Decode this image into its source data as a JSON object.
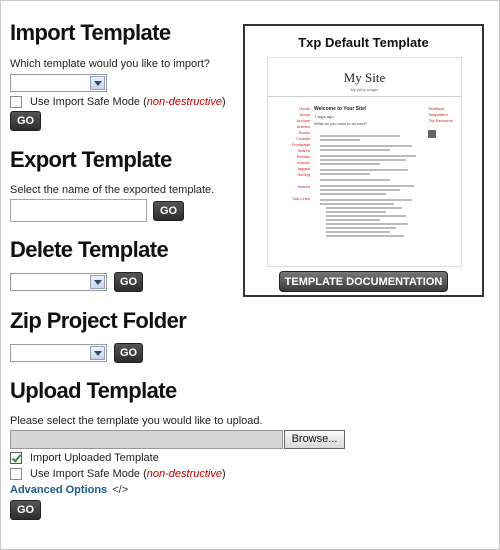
{
  "import": {
    "heading": "Import Template",
    "prompt": "Which template would you like to import?",
    "safe_mode_label": "Use Import Safe Mode (",
    "safe_mode_note": "non-destructive",
    "safe_mode_close": ")",
    "safe_mode_checked": false,
    "go_label": "GO"
  },
  "export": {
    "heading": "Export Template",
    "prompt": "Select the name of the exported template.",
    "name_value": "",
    "go_label": "GO"
  },
  "delete": {
    "heading": "Delete Template",
    "go_label": "GO"
  },
  "zip": {
    "heading": "Zip Project Folder",
    "go_label": "GO"
  },
  "upload": {
    "heading": "Upload Template",
    "prompt": "Please select the template you would like to upload.",
    "browse_label": "Browse...",
    "import_uploaded_label": "Import Uploaded Template",
    "import_uploaded_checked": true,
    "safe_mode_label": "Use Import Safe Mode (",
    "safe_mode_note": "non-destructive",
    "safe_mode_close": ")",
    "safe_mode_checked": false,
    "advanced_label": "Advanced Options",
    "advanced_suffix": "</>",
    "go_label": "GO"
  },
  "preview": {
    "title": "Txp Default Template",
    "site_title": "My Site",
    "site_slogan": "My pithy slogan",
    "article_title": "Welcome to Your Site!",
    "article_date": "7 days ago",
    "article_lead": "What do you want to do next?",
    "doc_button": "TEMPLATE DOCUMENTATION"
  },
  "colors": {
    "accent_red": "#c00000",
    "link_blue": "#1a5a8a",
    "check_green": "#2f8a2f",
    "button_dark": "#333333"
  }
}
